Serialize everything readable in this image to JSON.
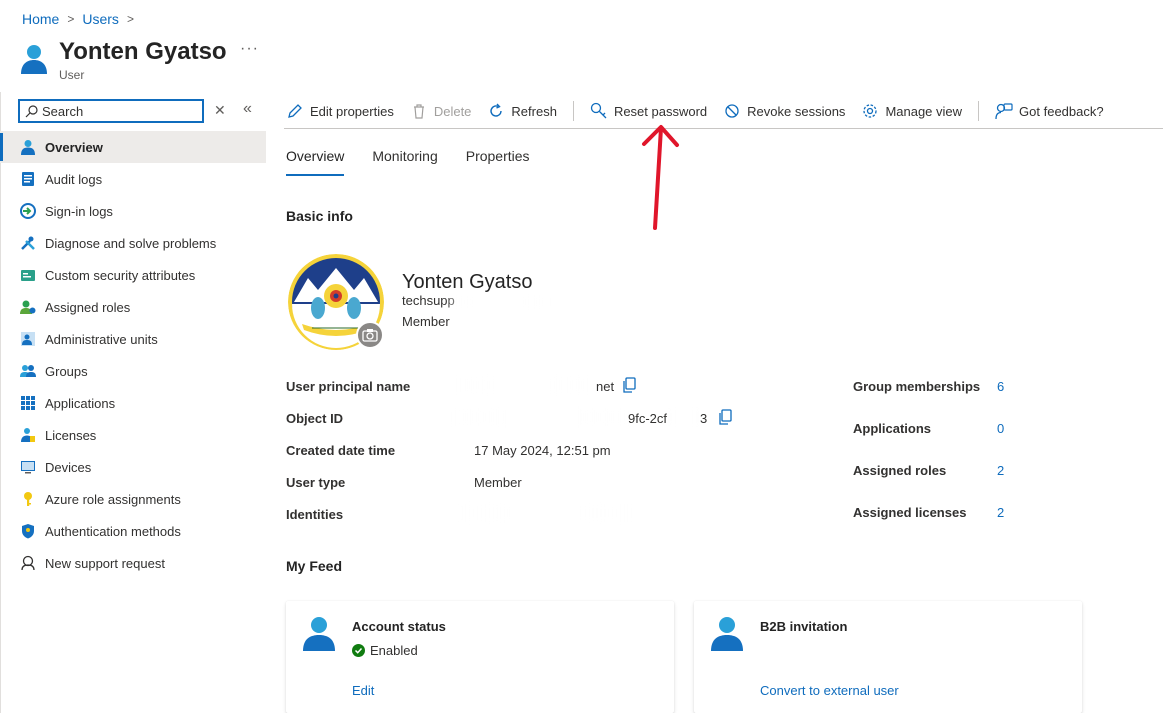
{
  "breadcrumb": [
    "Home",
    "Users"
  ],
  "header": {
    "title": "Yonten Gyatso",
    "subtitle": "User",
    "more": "···"
  },
  "sidebar": {
    "search_placeholder": "Search",
    "items": [
      {
        "label": "Overview",
        "icon": "user-icon",
        "active": true
      },
      {
        "label": "Audit logs",
        "icon": "audit-log-icon"
      },
      {
        "label": "Sign-in logs",
        "icon": "sign-in-icon"
      },
      {
        "label": "Diagnose and solve problems",
        "icon": "wrench-icon"
      },
      {
        "label": "Custom security attributes",
        "icon": "attributes-icon"
      },
      {
        "label": "Assigned roles",
        "icon": "roles-icon"
      },
      {
        "label": "Administrative units",
        "icon": "admin-units-icon"
      },
      {
        "label": "Groups",
        "icon": "groups-icon"
      },
      {
        "label": "Applications",
        "icon": "apps-grid-icon"
      },
      {
        "label": "Licenses",
        "icon": "license-icon"
      },
      {
        "label": "Devices",
        "icon": "device-icon"
      },
      {
        "label": "Azure role assignments",
        "icon": "key-icon"
      },
      {
        "label": "Authentication methods",
        "icon": "shield-icon"
      },
      {
        "label": "New support request",
        "icon": "support-icon"
      }
    ]
  },
  "toolbar": {
    "edit": "Edit properties",
    "delete": "Delete",
    "refresh": "Refresh",
    "reset_password": "Reset password",
    "revoke_sessions": "Revoke sessions",
    "manage_view": "Manage view",
    "feedback": "Got feedback?"
  },
  "tabs": [
    "Overview",
    "Monitoring",
    "Properties"
  ],
  "basic_info": {
    "title": "Basic info",
    "name": "Yonten Gyatso",
    "email_visible": "techsupp",
    "role": "Member"
  },
  "properties": {
    "upn_label": "User principal name",
    "upn_value_visible": "net",
    "object_id_label": "Object ID",
    "object_id_visible_a": "9fc-2cf",
    "object_id_visible_b": "3",
    "created_label": "Created date time",
    "created_value": "17 May 2024, 12:51 pm",
    "user_type_label": "User type",
    "user_type_value": "Member",
    "identities_label": "Identities"
  },
  "stats": [
    {
      "label": "Group memberships",
      "value": "6"
    },
    {
      "label": "Applications",
      "value": "0"
    },
    {
      "label": "Assigned roles",
      "value": "2"
    },
    {
      "label": "Assigned licenses",
      "value": "2"
    }
  ],
  "feed": {
    "title": "My Feed",
    "account_status": {
      "title": "Account status",
      "status": "Enabled",
      "action": "Edit"
    },
    "b2b": {
      "title": "B2B invitation",
      "action": "Convert to external user"
    }
  },
  "colors": {
    "accent": "#0f6cbd",
    "annotation": "#e0162b",
    "success": "#107c10"
  }
}
